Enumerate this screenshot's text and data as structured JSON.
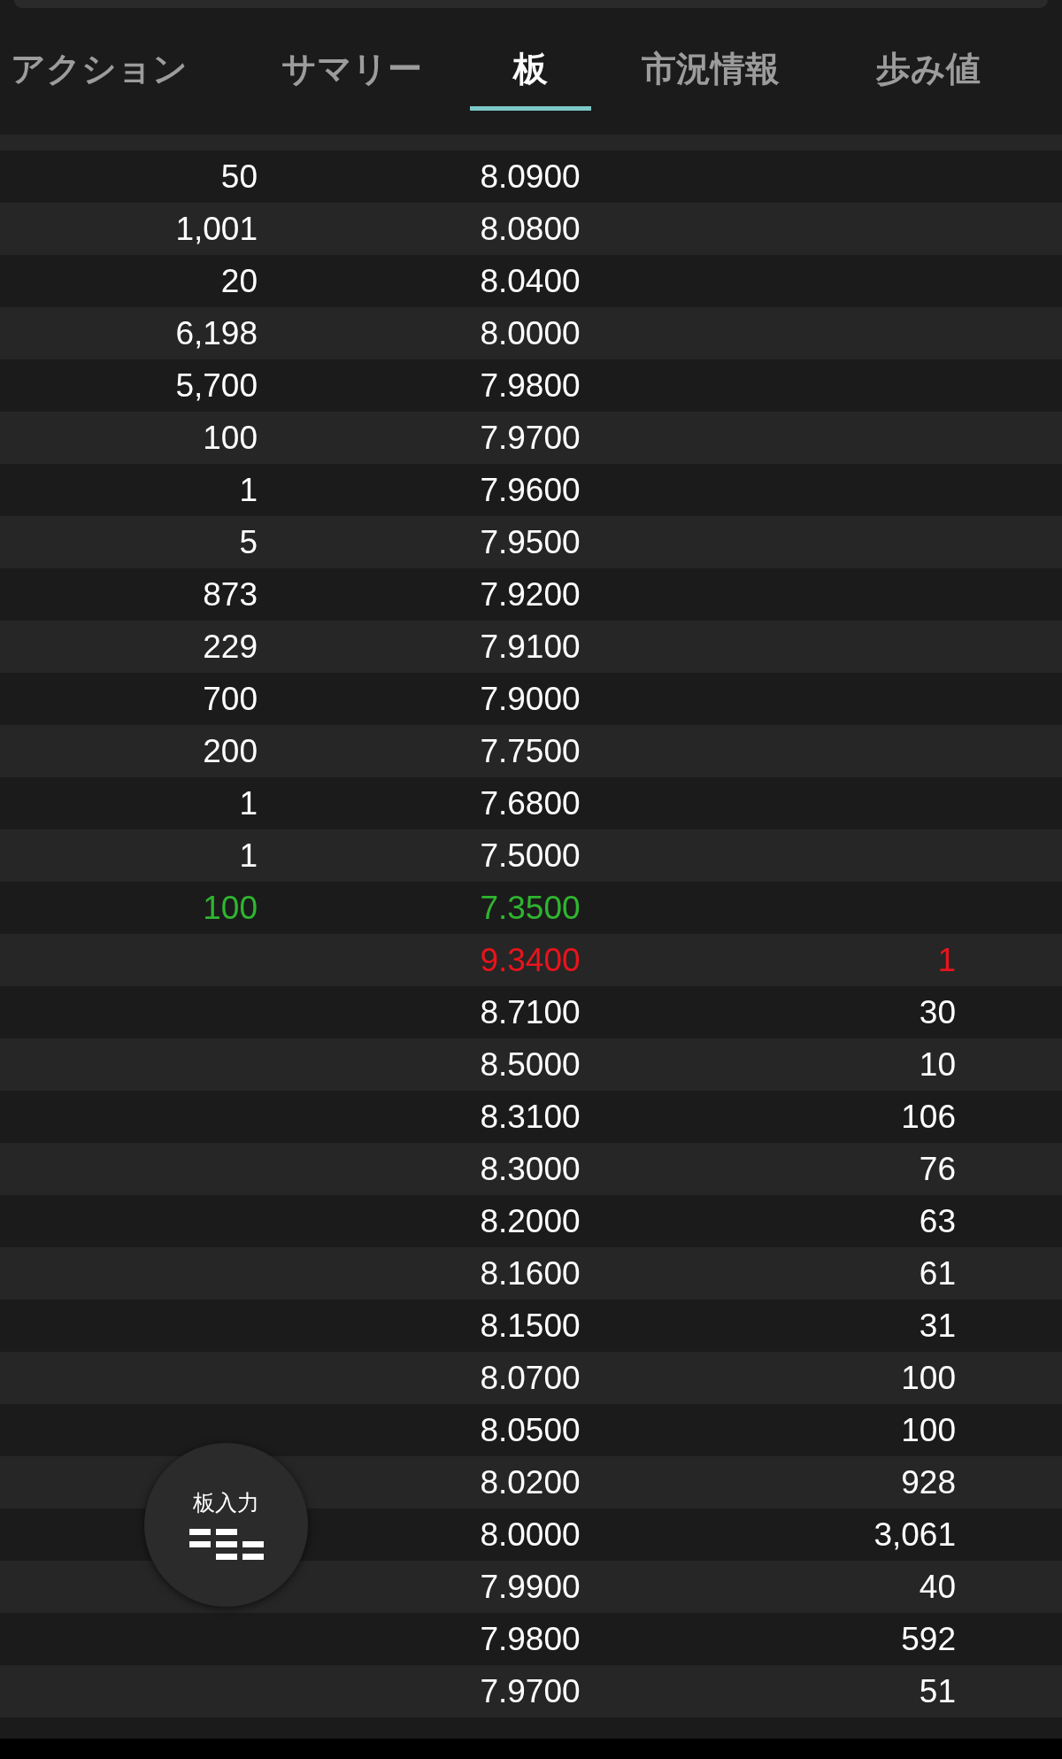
{
  "tabs": [
    {
      "label": "アクション",
      "selected": false
    },
    {
      "label": "サマリー",
      "selected": false
    },
    {
      "label": "板",
      "selected": true
    },
    {
      "label": "市況情報",
      "selected": false
    },
    {
      "label": "歩み値",
      "selected": false
    }
  ],
  "rows": [
    {
      "bid": "50",
      "price": "8.0900",
      "color": "#ffffff"
    },
    {
      "bid": "1,001",
      "price": "8.0800",
      "color": "#ffffff"
    },
    {
      "bid": "20",
      "price": "8.0400",
      "color": "#ffffff"
    },
    {
      "bid": "6,198",
      "price": "8.0000",
      "color": "#ffffff"
    },
    {
      "bid": "5,700",
      "price": "7.9800",
      "color": "#ffffff"
    },
    {
      "bid": "100",
      "price": "7.9700",
      "color": "#ffffff"
    },
    {
      "bid": "1",
      "price": "7.9600",
      "color": "#ffffff"
    },
    {
      "bid": "5",
      "price": "7.9500",
      "color": "#ffffff"
    },
    {
      "bid": "873",
      "price": "7.9200",
      "color": "#ffffff"
    },
    {
      "bid": "229",
      "price": "7.9100",
      "color": "#ffffff"
    },
    {
      "bid": "700",
      "price": "7.9000",
      "color": "#ffffff"
    },
    {
      "bid": "200",
      "price": "7.7500",
      "color": "#ffffff"
    },
    {
      "bid": "1",
      "price": "7.6800",
      "color": "#ffffff"
    },
    {
      "bid": "1",
      "price": "7.5000",
      "color": "#ffffff"
    },
    {
      "bid": "100",
      "price": "7.3500",
      "color": "#2fb52f"
    },
    {
      "price": "9.3400",
      "ask": "1",
      "color": "#e8141c"
    },
    {
      "price": "8.7100",
      "ask": "30",
      "color": "#ffffff"
    },
    {
      "price": "8.5000",
      "ask": "10",
      "color": "#ffffff"
    },
    {
      "price": "8.3100",
      "ask": "106",
      "color": "#ffffff"
    },
    {
      "price": "8.3000",
      "ask": "76",
      "color": "#ffffff"
    },
    {
      "price": "8.2000",
      "ask": "63",
      "color": "#ffffff"
    },
    {
      "price": "8.1600",
      "ask": "61",
      "color": "#ffffff"
    },
    {
      "price": "8.1500",
      "ask": "31",
      "color": "#ffffff"
    },
    {
      "price": "8.0700",
      "ask": "100",
      "color": "#ffffff"
    },
    {
      "price": "8.0500",
      "ask": "100",
      "color": "#ffffff"
    },
    {
      "price": "8.0200",
      "ask": "928",
      "color": "#ffffff"
    },
    {
      "price": "8.0000",
      "ask": "3,061",
      "color": "#ffffff"
    },
    {
      "price": "7.9900",
      "ask": "40",
      "color": "#ffffff"
    },
    {
      "price": "7.9800",
      "ask": "592",
      "color": "#ffffff"
    },
    {
      "price": "7.9700",
      "ask": "51",
      "color": "#ffffff"
    }
  ],
  "board_input_button": {
    "label": "板入力"
  }
}
